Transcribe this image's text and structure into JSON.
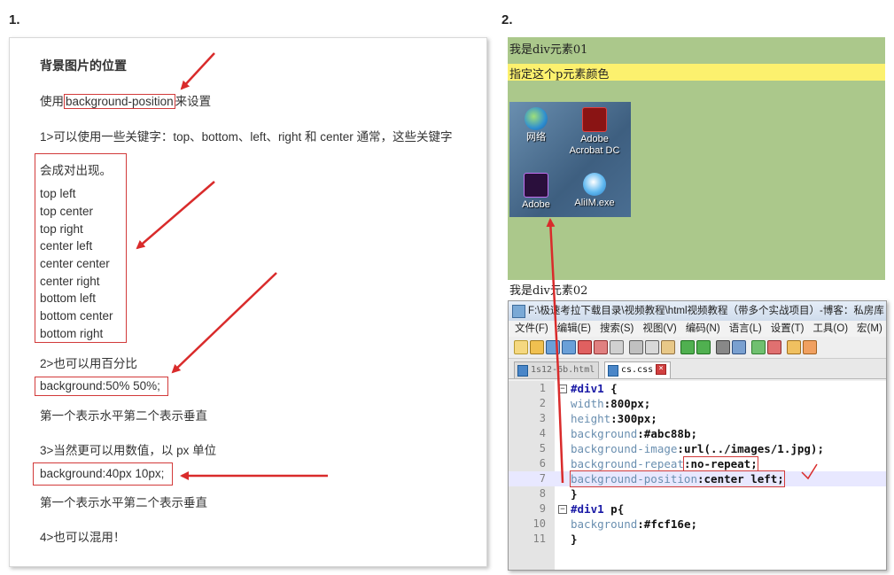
{
  "labels": {
    "one": "1.",
    "two": "2."
  },
  "left": {
    "heading": "背景图片的位置",
    "use_prefix": "使用",
    "use_code": "background-position",
    "use_suffix": "来设置",
    "line1": "1>可以使用一些关键字：top、bottom、left、right 和 center 通常，这些关键字",
    "line1b": "会成对出现。",
    "keywords": [
      "top left",
      "top center",
      "top right",
      "center left",
      "center center",
      "center right",
      "bottom left",
      "bottom center",
      "bottom right"
    ],
    "line2": "2>也可以用百分比",
    "code2": "background:50% 50%;",
    "desc2": "第一个表示水平第二个表示垂直",
    "line3": "3>当然更可以用数值，以 px 单位",
    "code3": "background:40px 10px;",
    "desc3": "第一个表示水平第二个表示垂直",
    "line4": "4>也可以混用！"
  },
  "right": {
    "div1": "我是div元素01",
    "p": "指定这个p元素颜色",
    "icons": [
      {
        "name": "网络",
        "line2": ""
      },
      {
        "name": "Adobe",
        "line2": "Acrobat DC"
      },
      {
        "name": "Adobe",
        "line2": ""
      },
      {
        "name": "AliIM.exe",
        "line2": ""
      }
    ],
    "div2": "我是div元素02"
  },
  "notepad": {
    "title": "F:\\极速考拉下载目录\\视频教程\\html视频教程（带多个实战项目）-博客：私房库 (",
    "menu": [
      "文件(F)",
      "编辑(E)",
      "搜索(S)",
      "视图(V)",
      "编码(N)",
      "语言(L)",
      "设置(T)",
      "工具(O)",
      "宏(M)"
    ],
    "tabs": [
      "1s12-6b.html",
      "cs.css"
    ],
    "code": [
      {
        "n": "1",
        "a": "#div1",
        "b": " {"
      },
      {
        "n": "2",
        "a": "width",
        "b": ":800px;"
      },
      {
        "n": "3",
        "a": "height",
        "b": ":300px;"
      },
      {
        "n": "4",
        "a": "background",
        "b": ":#abc88b;"
      },
      {
        "n": "5",
        "a": "background-image",
        "b": ":url(../images/1.jpg);"
      },
      {
        "n": "6",
        "a": "background-repeat",
        "b": ":no-repeat;"
      },
      {
        "n": "7",
        "a": "background-position",
        "b": ":center left;"
      },
      {
        "n": "8",
        "a": "}",
        "b": ""
      },
      {
        "n": "9",
        "a": "#div1",
        "b": " p{"
      },
      {
        "n": "10",
        "a": "background",
        "b": ":#fcf16e;"
      },
      {
        "n": "11",
        "a": "}",
        "b": ""
      }
    ]
  },
  "colors": {
    "green": "#abc88b",
    "yellow": "#fcf16e",
    "red": "#d23a3a"
  }
}
